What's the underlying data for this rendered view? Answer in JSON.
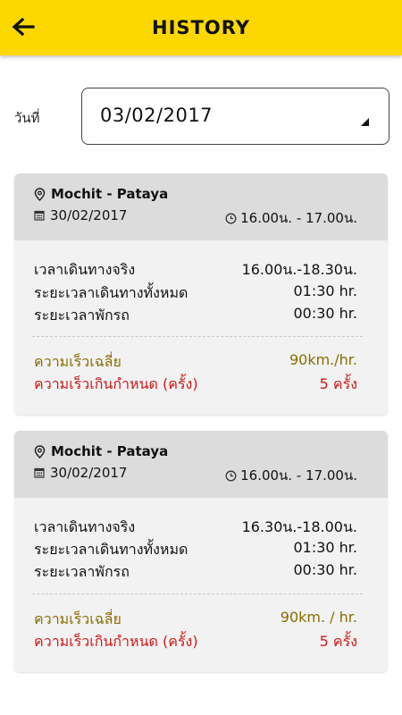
{
  "header": {
    "title": "HISTORY"
  },
  "filter": {
    "label": "วันที่",
    "selected_date": "03/02/2017"
  },
  "colors": {
    "appbar": "#fcd800",
    "speed_avg": "#8a6d00",
    "speed_over": "#cc1a1a"
  },
  "trips": [
    {
      "route": "Mochit - Pataya",
      "date": "30/02/2017",
      "time": "16.00น. - 17.00น.",
      "actual_label": "เวลาเดินทางจริง",
      "actual_value": "16.00น.-18.30น.",
      "total_label": "ระยะเวลาเดินทางทั้งหมด",
      "total_value": "01:30 hr.",
      "rest_label": "ระยะเวลาพักรถ",
      "rest_value": "00:30 hr.",
      "avg_label": "ความเร็วเฉลี่ย",
      "avg_value": "90km./hr.",
      "over_label": "ความเร็วเกินกำหนด (ครั้ง)",
      "over_value": "5 ครั้ง"
    },
    {
      "route": "Mochit - Pataya",
      "date": "30/02/2017",
      "time": "16.00น. - 17.00น.",
      "actual_label": "เวลาเดินทางจริง",
      "actual_value": "16.30น.-18.00น.",
      "total_label": "ระยะเวลาเดินทางทั้งหมด",
      "total_value": "01:30 hr.",
      "rest_label": "ระยะเวลาพักรถ",
      "rest_value": "00:30 hr.",
      "avg_label": "ความเร็วเฉลี่ย",
      "avg_value": "90km. / hr.",
      "over_label": "ความเร็วเกินกำหนด (ครั้ง)",
      "over_value": "5 ครั้ง"
    }
  ]
}
